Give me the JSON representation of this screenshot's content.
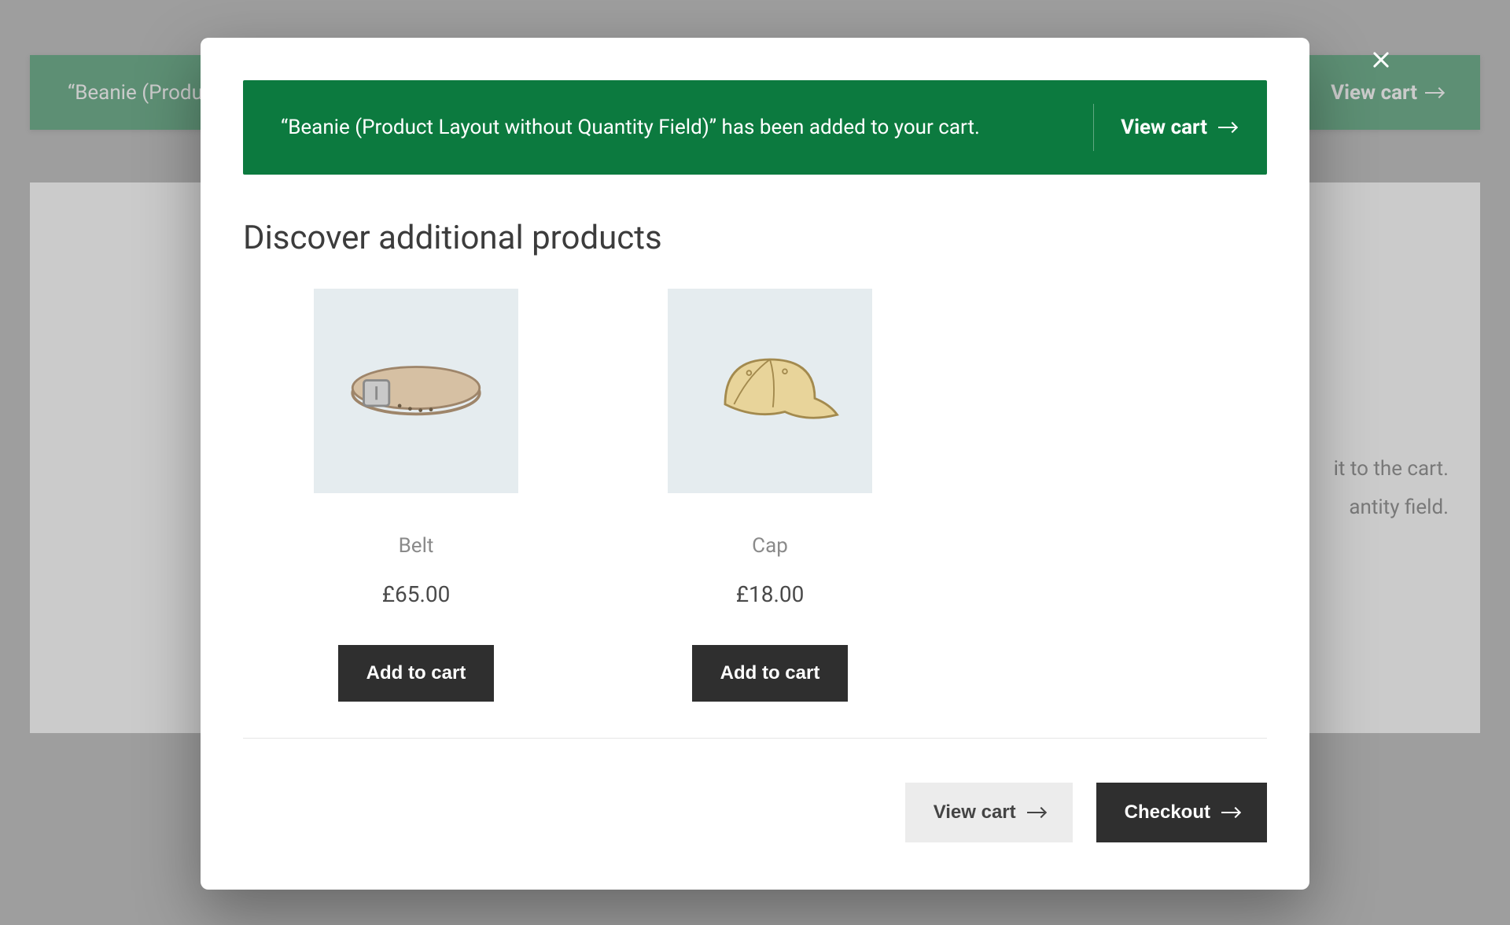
{
  "background": {
    "banner_message": "“Beanie (Product Layout without Quantity Field)” has been added to your cart.",
    "banner_action": "View cart",
    "para_line1": "it to the cart.",
    "para_line2": "antity field."
  },
  "modal": {
    "notice_message": "“Beanie (Product Layout without Quantity Field)” has been added to your cart.",
    "notice_action": "View cart",
    "section_title": "Discover additional products",
    "products": [
      {
        "name": "Belt",
        "price": "£65.00",
        "button": "Add to cart",
        "icon": "belt"
      },
      {
        "name": "Cap",
        "price": "£18.00",
        "button": "Add to cart",
        "icon": "cap"
      }
    ],
    "footer": {
      "view_cart": "View cart",
      "checkout": "Checkout"
    }
  }
}
